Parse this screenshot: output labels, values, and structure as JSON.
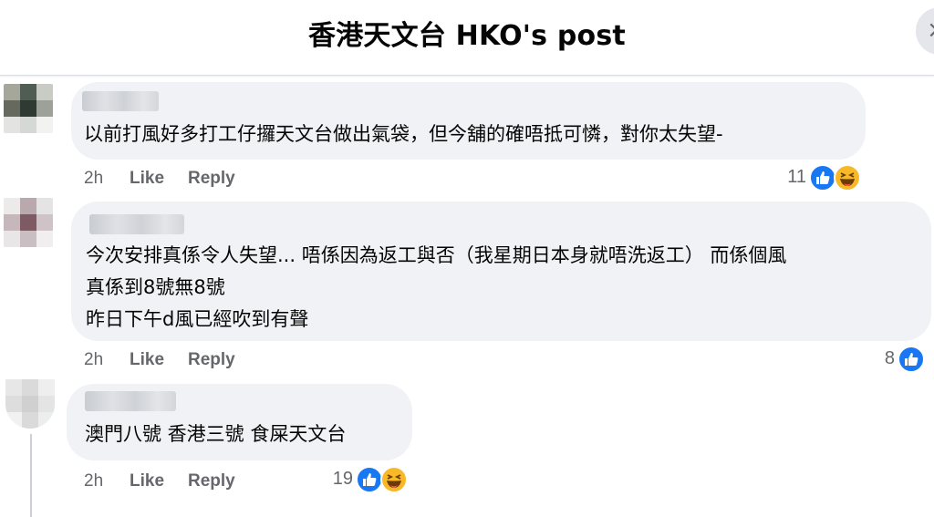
{
  "header": {
    "title": "香港天文台 HKO's post",
    "close_glyph": "×"
  },
  "comments": [
    {
      "text_lines": [
        "以前打風好多打工仔攞天文台做出氣袋，但今舖的確唔抵可憐，對你太失望-"
      ],
      "time": "2h",
      "like_label": "Like",
      "reply_label": "Reply",
      "reaction_count": "11",
      "reactions": [
        "like-icon",
        "haha-icon"
      ]
    },
    {
      "text_lines": [
        "今次安排真係令人失望... 唔係因為返工與否（我星期日本身就唔洗返工） 而係個風",
        "真係到8號無8號",
        "昨日下午d風已經吹到有聲"
      ],
      "time": "2h",
      "like_label": "Like",
      "reply_label": "Reply",
      "reaction_count": "8",
      "reactions": [
        "like-icon"
      ]
    },
    {
      "text_lines": [
        "澳門八號 香港三號 食屎天文台"
      ],
      "time": "2h",
      "like_label": "Like",
      "reply_label": "Reply",
      "reaction_count": "19",
      "reactions": [
        "like-icon",
        "haha-icon"
      ]
    }
  ],
  "colors": {
    "bubble": "#f0f2f5",
    "like_blue": "#1877f2",
    "haha_yellow": "#f7b928",
    "meta_grey": "#65676b"
  }
}
